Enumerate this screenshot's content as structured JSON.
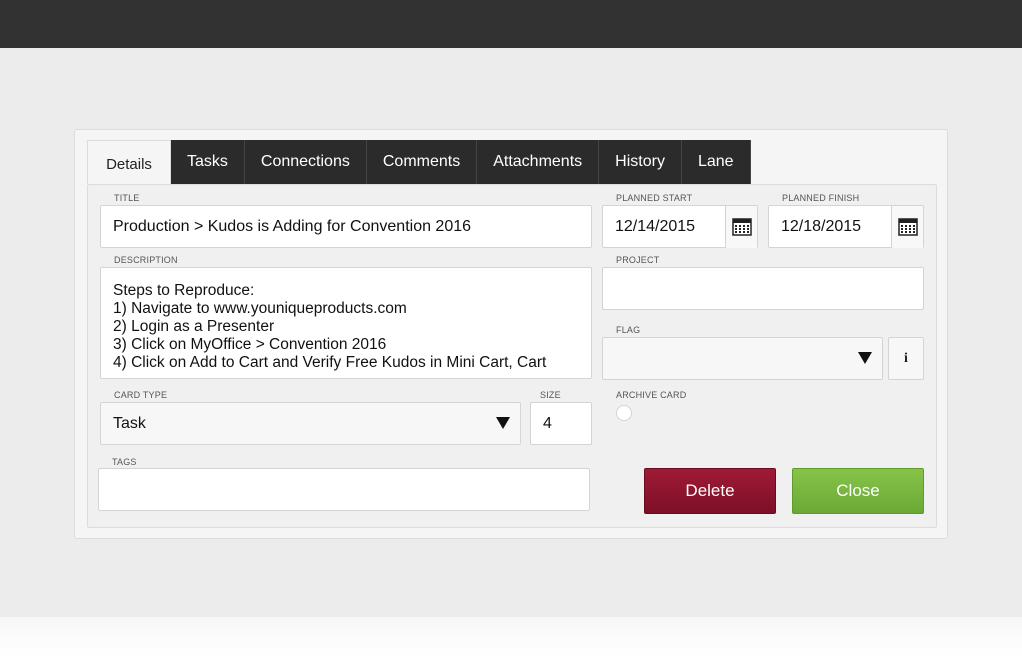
{
  "tabs": [
    "Details",
    "Tasks",
    "Connections",
    "Comments",
    "Attachments",
    "History",
    "Lane"
  ],
  "form": {
    "title_label": "TITLE",
    "title_value": "Production > Kudos is Adding for Convention 2016",
    "planned_start_label": "PLANNED START",
    "planned_start_value": "12/14/2015",
    "planned_finish_label": "PLANNED FINISH",
    "planned_finish_value": "12/18/2015",
    "description_label": "DESCRIPTION",
    "description_lines": [
      "Steps to Reproduce:",
      "1) Navigate to www.youniqueproducts.com",
      "2) Login as a Presenter",
      "3) Click on  MyOffice > Convention 2016",
      "4) Click on Add to Cart and Verify Free Kudos in Mini Cart, Cart"
    ],
    "project_label": "PROJECT",
    "project_value": "",
    "flag_label": "FLAG",
    "flag_value": "",
    "info_glyph": "i",
    "card_type_label": "CARD TYPE",
    "card_type_value": "Task",
    "size_label": "SIZE",
    "size_value": "4",
    "archive_label": "ARCHIVE CARD",
    "tags_label": "TAGS",
    "tags_value": ""
  },
  "buttons": {
    "delete": "Delete",
    "close": "Close"
  },
  "colors": {
    "topbar": "#323232",
    "delete": "#8b1430",
    "close": "#78b73f"
  }
}
